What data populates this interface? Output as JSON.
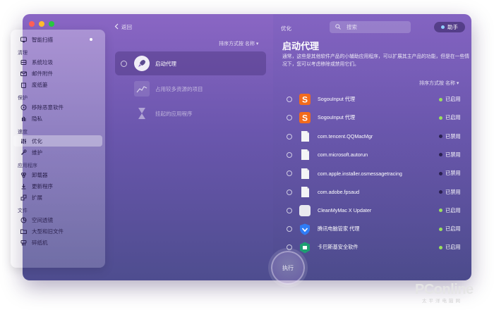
{
  "sidebar": {
    "top_item": {
      "label": "智能扫描",
      "icon": "monitor-scan-icon"
    },
    "sections": [
      {
        "title": "清理",
        "items": [
          {
            "label": "系统垃圾",
            "icon": "disk-icon"
          },
          {
            "label": "邮件附件",
            "icon": "mail-icon"
          },
          {
            "label": "废纸篓",
            "icon": "trash-icon"
          }
        ]
      },
      {
        "title": "保护",
        "items": [
          {
            "label": "移除恶意软件",
            "icon": "biohazard-icon"
          },
          {
            "label": "隐私",
            "icon": "hand-icon"
          }
        ]
      },
      {
        "title": "速度",
        "items": [
          {
            "label": "优化",
            "icon": "sliders-icon"
          },
          {
            "label": "维护",
            "icon": "wrench-icon"
          }
        ]
      },
      {
        "title": "应用程序",
        "items": [
          {
            "label": "卸载器",
            "icon": "uninstall-icon"
          },
          {
            "label": "更新程序",
            "icon": "update-icon"
          },
          {
            "label": "扩展",
            "icon": "extension-icon"
          }
        ]
      },
      {
        "title": "文件",
        "items": [
          {
            "label": "空间透镜",
            "icon": "lens-icon"
          },
          {
            "label": "大型和旧文件",
            "icon": "folder-icon"
          },
          {
            "label": "碎纸机",
            "icon": "shredder-icon"
          }
        ]
      }
    ]
  },
  "toolbar": {
    "back_label": "返回",
    "title": "优化",
    "search_placeholder": "搜索",
    "help_label": "助手"
  },
  "middle": {
    "sort_label": "排序方式按 名称 ▾",
    "items": [
      {
        "label": "启动代理",
        "icon": "rocket-icon",
        "selected": true
      },
      {
        "label": "占用较多资源的项目",
        "icon": "chart-icon",
        "selected": false
      },
      {
        "label": "挂起的应用程序",
        "icon": "hourglass-icon",
        "selected": false
      }
    ]
  },
  "right": {
    "title": "启动代理",
    "description": "通常，这些是其他软件产品的小辅助应用程序，可以扩展其主产品的功能，但是在一些情况下，您可以考虑移除或禁用它们。",
    "sort_label": "排序方式按 名称 ▾",
    "rows": [
      {
        "name": "SogouInput 代理",
        "icon": "sogou-icon",
        "status": "已启用",
        "enabled": true
      },
      {
        "name": "SogouInput 代理",
        "icon": "sogou-icon",
        "status": "已启用",
        "enabled": true
      },
      {
        "name": "com.tencent.QQMacMgr",
        "icon": "file-icon",
        "status": "已禁用",
        "enabled": false
      },
      {
        "name": "com.microsoft.autorun",
        "icon": "file-icon",
        "status": "已禁用",
        "enabled": false
      },
      {
        "name": "com.apple.installer.osmessagetracing",
        "icon": "file-icon",
        "status": "已禁用",
        "enabled": false
      },
      {
        "name": "com.adobe.fpsaud",
        "icon": "file-icon",
        "status": "已禁用",
        "enabled": false
      },
      {
        "name": "CleanMyMac X Updater",
        "icon": "app-icon",
        "status": "已启用",
        "enabled": true
      },
      {
        "name": "腾讯电脑管家 代理",
        "icon": "shield-icon",
        "status": "已启用",
        "enabled": true
      },
      {
        "name": "卡巴斯基安全软件",
        "icon": "kaspersky-icon",
        "status": "已启用",
        "enabled": true
      }
    ]
  },
  "execute_label": "执行",
  "watermark": {
    "main": "PConline",
    "sub": "太平洋电脑网"
  },
  "colors": {
    "enabled": "#9be15d",
    "disabled": "#2a2050",
    "accent": "#8a66c4"
  }
}
